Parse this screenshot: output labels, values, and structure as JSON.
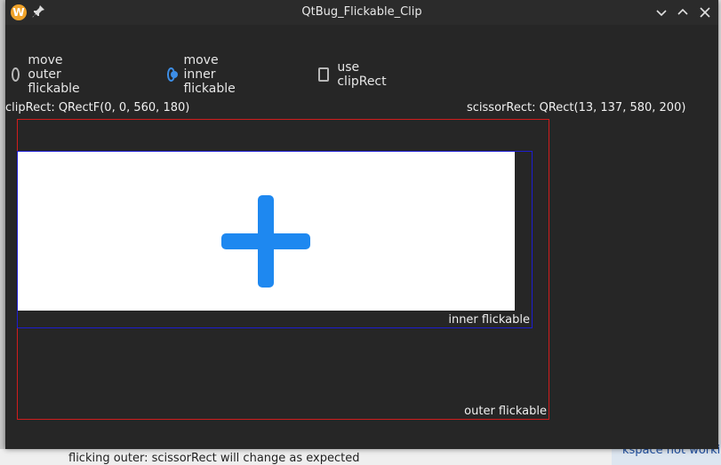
{
  "window": {
    "title": "QtBug_Flickable_Clip",
    "app_icon": "W"
  },
  "options": {
    "outer_label": "move outer flickable",
    "inner_label": "move inner flickable",
    "clip_label": "use clipRect",
    "selected": "move inner flickable",
    "use_clip_rect": false
  },
  "info": {
    "clip_rect": "clipRect: QRectF(0, 0, 560, 180)",
    "scissor_rect": "scissorRect: QRect(13, 137, 580, 200)"
  },
  "labels": {
    "inner": "inner flickable",
    "outer": "outer flickable"
  },
  "background": {
    "bottom_text": "flicking outer: scissorRect will change as expected",
    "bottom_right_text": "kspace not workin"
  },
  "colors": {
    "window_bg": "#262626",
    "accent": "#3d8ee6",
    "outer_border": "#d01d1d",
    "inner_border": "#1d1dd0",
    "plus": "#1e88f0"
  },
  "icons": {
    "content": "plus-icon"
  }
}
